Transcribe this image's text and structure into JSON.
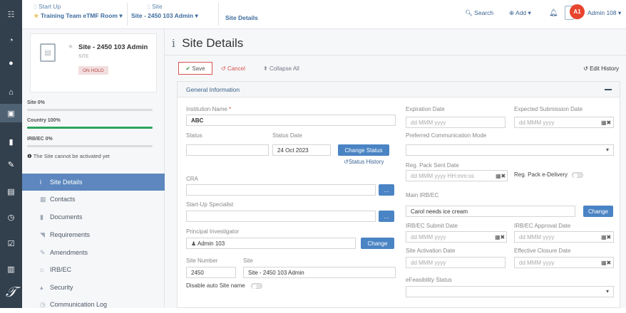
{
  "header": {
    "crumb1_title": "Start Up",
    "crumb1_value": "Training Team eTMF Room",
    "crumb2_title": "Site",
    "crumb2_value": "Site - 2450 103 Admin",
    "crumb3": "Site Details",
    "search": "Search",
    "add": "Add",
    "user_initials": "A1",
    "user_name": "Admin 108"
  },
  "site_card": {
    "name": "Site - 2450 103 Admin",
    "type": "SITE",
    "status": "ON HOLD"
  },
  "progress": [
    {
      "label": "Site 0%",
      "value": 0
    },
    {
      "label": "Country 100%",
      "value": 100
    },
    {
      "label": "IRB/EC 0%",
      "value": 0
    }
  ],
  "activation_note": "The Site cannot be activated yet",
  "menu": [
    {
      "label": "Site Details",
      "active": true
    },
    {
      "label": "Contacts"
    },
    {
      "label": "Documents"
    },
    {
      "label": "Requirements"
    },
    {
      "label": "Amendments"
    },
    {
      "label": "IRB/EC"
    },
    {
      "label": "Security"
    },
    {
      "label": "Communication Log"
    }
  ],
  "page": {
    "title": "Site Details",
    "save": "Save",
    "cancel": "Cancel",
    "collapse": "Collapse All",
    "edit_history": "Edit History",
    "section": "General Information"
  },
  "form": {
    "institution_label": "Institution Name",
    "institution_value": "ABC",
    "status_label": "Status",
    "status_value": "",
    "status_date_label": "Status Date",
    "status_date_value": "24 Oct 2023",
    "change_status": "Change Status",
    "status_history": "Status History",
    "cra_label": "CRA",
    "startup_label": "Start-Up Specialist",
    "pi_label": "Principal Investigator",
    "pi_value": "Admin 103",
    "change": "Change",
    "site_number_label": "Site Number",
    "site_number_value": "2450",
    "site_label": "Site",
    "site_value": "Site - 2450 103 Admin",
    "disable_auto": "Disable auto Site name",
    "expiration_label": "Expiration Date",
    "expected_sub_label": "Expected Submission Date",
    "date_placeholder": "dd MMM yyyy",
    "datetime_placeholder": "dd MMM yyyy HH:mm:ss",
    "pref_comm_label": "Preferred Communication Mode",
    "reg_pack_label": "Reg. Pack Sent Date",
    "reg_pack_edelivery": "Reg. Pack e-Delivery",
    "main_irb_label": "Main IRB/EC",
    "main_irb_value": "Carol needs ice cream",
    "irb_submit_label": "IRB/EC Submit Date",
    "irb_approval_label": "IRB/EC Approval Date",
    "site_activation_label": "Site Activation Date",
    "effective_closure_label": "Effective Closure Date",
    "efeasibility_label": "eFeasibility Status"
  }
}
